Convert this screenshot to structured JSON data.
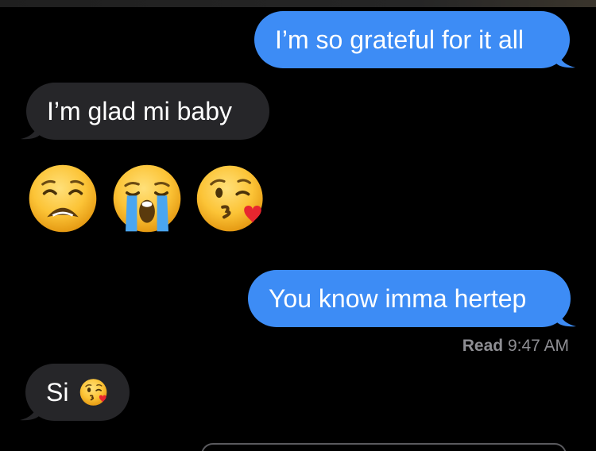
{
  "messages": [
    {
      "direction": "sent",
      "text": "I’m so grateful for it all"
    },
    {
      "direction": "received",
      "text": "I’m glad mi baby"
    },
    {
      "direction": "received",
      "emojis": [
        "weary-face",
        "loudly-crying-face",
        "face-blowing-kiss"
      ]
    },
    {
      "direction": "sent",
      "text": "You know imma hertep"
    },
    {
      "direction": "received",
      "text": "Si",
      "emoji": "face-blowing-kiss"
    }
  ],
  "receipt": {
    "label": "Read",
    "time": "9:47 AM"
  },
  "colors": {
    "sent_bubble": "#3d8cf5",
    "received_bubble": "#262629",
    "background": "#000000",
    "receipt_text": "#8e8e93"
  }
}
